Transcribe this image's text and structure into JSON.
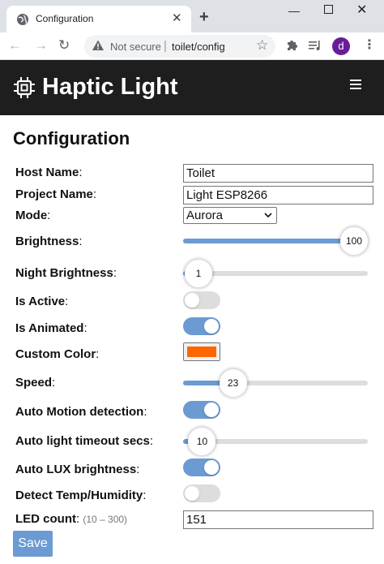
{
  "browser": {
    "tab_title": "Configuration",
    "tab_close": "✕",
    "new_tab": "+",
    "window_min": "—",
    "window_close": "✕",
    "not_secure": "Not secure",
    "pipe": "|",
    "url": "toilet/config",
    "profile_initial": "d"
  },
  "app": {
    "brand": "Haptic Light"
  },
  "page": {
    "title": "Configuration"
  },
  "form": {
    "host_name": {
      "label": "Host Name",
      "value": "Toilet"
    },
    "project_name": {
      "label": "Project Name",
      "value": "Light ESP8266"
    },
    "mode": {
      "label": "Mode",
      "value": "Aurora"
    },
    "brightness": {
      "label": "Brightness",
      "value": 100,
      "value_text": "100",
      "min": 0,
      "max": 100
    },
    "night_brightness": {
      "label": "Night Brightness",
      "value": 1,
      "value_text": "1",
      "min": 0,
      "max": 100
    },
    "is_active": {
      "label": "Is Active",
      "on": false
    },
    "is_animated": {
      "label": "Is Animated",
      "on": true
    },
    "custom_color": {
      "label": "Custom Color",
      "value": "#ff6600"
    },
    "speed": {
      "label": "Speed",
      "value": 23,
      "value_text": "23",
      "min": 0,
      "max": 100
    },
    "auto_motion": {
      "label": "Auto Motion detection",
      "on": true
    },
    "auto_light_timeout": {
      "label": "Auto light timeout secs",
      "value": 10,
      "value_text": "10",
      "min": 0,
      "max": 300
    },
    "auto_lux": {
      "label": "Auto LUX brightness",
      "on": true
    },
    "detect_temp": {
      "label": "Detect Temp/Humidity",
      "on": false
    },
    "led_count": {
      "label": "LED count",
      "hint": "(10 – 300)",
      "value": "151"
    },
    "save_label": "Save"
  },
  "colors": {
    "accent": "#6b9bd2",
    "header_bg": "#1e1e1e",
    "custom_color": "#ff6600"
  },
  "icons": {
    "tab": "globe-icon",
    "address": "warning-triangle-icon",
    "brand": "chip-icon",
    "menu": "hamburger-icon"
  }
}
